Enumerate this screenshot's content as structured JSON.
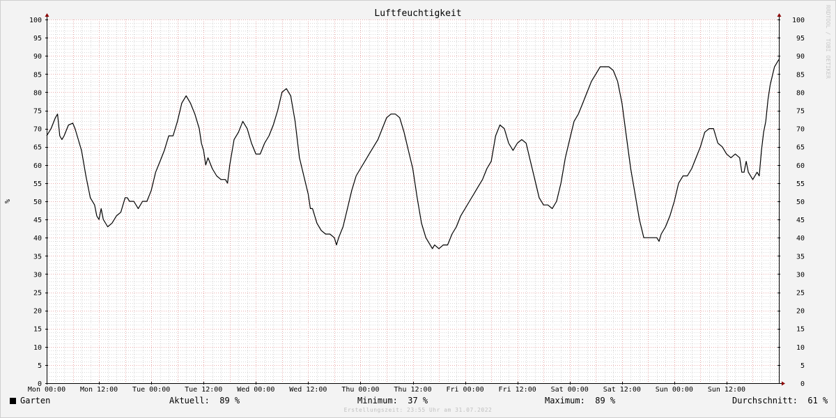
{
  "chart_data": {
    "type": "line",
    "title": "Luftfeuchtigkeit",
    "ylabel": "%",
    "ylim": [
      0,
      100
    ],
    "y_ticks": [
      0,
      5,
      10,
      15,
      20,
      25,
      30,
      35,
      40,
      45,
      50,
      55,
      60,
      65,
      70,
      75,
      80,
      85,
      90,
      95,
      100
    ],
    "xlim": [
      0,
      168
    ],
    "x_ticks": [
      {
        "x": 0,
        "label": "Mon 00:00"
      },
      {
        "x": 12,
        "label": "Mon 12:00"
      },
      {
        "x": 24,
        "label": "Tue 00:00"
      },
      {
        "x": 36,
        "label": "Tue 12:00"
      },
      {
        "x": 48,
        "label": "Wed 00:00"
      },
      {
        "x": 60,
        "label": "Wed 12:00"
      },
      {
        "x": 72,
        "label": "Thu 00:00"
      },
      {
        "x": 84,
        "label": "Thu 12:00"
      },
      {
        "x": 96,
        "label": "Fri 00:00"
      },
      {
        "x": 108,
        "label": "Fri 12:00"
      },
      {
        "x": 120,
        "label": "Sat 00:00"
      },
      {
        "x": 132,
        "label": "Sat 12:00"
      },
      {
        "x": 144,
        "label": "Sun 00:00"
      },
      {
        "x": 156,
        "label": "Sun 12:00"
      }
    ],
    "grid": true,
    "series": [
      {
        "name": "Garten",
        "color": "#000000",
        "points": [
          [
            0,
            68
          ],
          [
            1,
            70
          ],
          [
            2,
            73
          ],
          [
            2.5,
            74
          ],
          [
            3,
            68
          ],
          [
            3.5,
            67
          ],
          [
            4,
            68
          ],
          [
            5,
            71
          ],
          [
            6,
            71.5
          ],
          [
            6.5,
            70
          ],
          [
            7,
            68
          ],
          [
            8,
            64
          ],
          [
            9,
            57
          ],
          [
            10,
            51
          ],
          [
            11,
            49
          ],
          [
            11.5,
            46
          ],
          [
            12,
            45
          ],
          [
            12.5,
            48
          ],
          [
            13,
            45
          ],
          [
            14,
            43
          ],
          [
            15,
            44
          ],
          [
            16,
            46
          ],
          [
            17,
            47
          ],
          [
            18,
            51
          ],
          [
            18.5,
            51
          ],
          [
            19,
            50
          ],
          [
            20,
            50
          ],
          [
            21,
            48
          ],
          [
            22,
            50
          ],
          [
            23,
            50
          ],
          [
            24,
            53
          ],
          [
            25,
            58
          ],
          [
            26,
            61
          ],
          [
            27,
            64
          ],
          [
            28,
            68
          ],
          [
            29,
            68
          ],
          [
            30,
            72
          ],
          [
            31,
            77
          ],
          [
            32,
            79
          ],
          [
            33,
            77
          ],
          [
            34,
            74
          ],
          [
            35,
            70
          ],
          [
            35.5,
            66
          ],
          [
            36,
            64
          ],
          [
            36.5,
            60
          ],
          [
            37,
            62
          ],
          [
            38,
            59
          ],
          [
            39,
            57
          ],
          [
            40,
            56
          ],
          [
            41,
            56
          ],
          [
            41.5,
            55
          ],
          [
            42,
            60
          ],
          [
            43,
            67
          ],
          [
            44,
            69
          ],
          [
            45,
            72
          ],
          [
            46,
            70
          ],
          [
            47,
            66
          ],
          [
            48,
            63
          ],
          [
            49,
            63
          ],
          [
            50,
            66
          ],
          [
            51,
            68
          ],
          [
            52,
            71
          ],
          [
            53,
            75
          ],
          [
            54,
            80
          ],
          [
            55,
            81
          ],
          [
            56,
            79
          ],
          [
            57,
            72
          ],
          [
            58,
            62
          ],
          [
            59,
            57
          ],
          [
            60,
            52
          ],
          [
            60.5,
            48
          ],
          [
            61,
            48
          ],
          [
            62,
            44
          ],
          [
            63,
            42
          ],
          [
            64,
            41
          ],
          [
            65,
            41
          ],
          [
            66,
            40
          ],
          [
            66.5,
            38
          ],
          [
            67,
            40
          ],
          [
            68,
            43
          ],
          [
            69,
            48
          ],
          [
            70,
            53
          ],
          [
            71,
            57
          ],
          [
            72,
            59
          ],
          [
            73,
            61
          ],
          [
            74,
            63
          ],
          [
            75,
            65
          ],
          [
            76,
            67
          ],
          [
            77,
            70
          ],
          [
            78,
            73
          ],
          [
            79,
            74
          ],
          [
            80,
            74
          ],
          [
            81,
            73
          ],
          [
            82,
            69
          ],
          [
            83,
            64
          ],
          [
            84,
            59
          ],
          [
            85,
            51
          ],
          [
            86,
            44
          ],
          [
            87,
            40
          ],
          [
            88,
            38
          ],
          [
            88.5,
            37
          ],
          [
            89,
            38
          ],
          [
            90,
            37
          ],
          [
            91,
            38
          ],
          [
            92,
            38
          ],
          [
            93,
            41
          ],
          [
            94,
            43
          ],
          [
            95,
            46
          ],
          [
            96,
            48
          ],
          [
            97,
            50
          ],
          [
            98,
            52
          ],
          [
            99,
            54
          ],
          [
            100,
            56
          ],
          [
            101,
            59
          ],
          [
            102,
            61
          ],
          [
            103,
            68
          ],
          [
            104,
            71
          ],
          [
            105,
            70
          ],
          [
            106,
            66
          ],
          [
            107,
            64
          ],
          [
            108,
            66
          ],
          [
            109,
            67
          ],
          [
            110,
            66
          ],
          [
            111,
            61
          ],
          [
            112,
            56
          ],
          [
            113,
            51
          ],
          [
            114,
            49
          ],
          [
            115,
            49
          ],
          [
            116,
            48
          ],
          [
            117,
            50
          ],
          [
            118,
            55
          ],
          [
            119,
            62
          ],
          [
            120,
            67
          ],
          [
            121,
            72
          ],
          [
            122,
            74
          ],
          [
            123,
            77
          ],
          [
            124,
            80
          ],
          [
            125,
            83
          ],
          [
            126,
            85
          ],
          [
            127,
            87
          ],
          [
            128,
            87
          ],
          [
            129,
            87
          ],
          [
            130,
            86
          ],
          [
            131,
            83
          ],
          [
            132,
            77
          ],
          [
            133,
            68
          ],
          [
            134,
            59
          ],
          [
            135,
            52
          ],
          [
            136,
            45
          ],
          [
            137,
            40
          ],
          [
            138,
            40
          ],
          [
            139,
            40
          ],
          [
            140,
            40
          ],
          [
            140.5,
            39
          ],
          [
            141,
            41
          ],
          [
            142,
            43
          ],
          [
            143,
            46
          ],
          [
            144,
            50
          ],
          [
            145,
            55
          ],
          [
            146,
            57
          ],
          [
            147,
            57
          ],
          [
            148,
            59
          ],
          [
            149,
            62
          ],
          [
            150,
            65
          ],
          [
            151,
            69
          ],
          [
            152,
            70
          ],
          [
            153,
            70
          ],
          [
            154,
            66
          ],
          [
            155,
            65
          ],
          [
            156,
            63
          ],
          [
            157,
            62
          ],
          [
            158,
            63
          ],
          [
            159,
            62
          ],
          [
            159.5,
            58
          ],
          [
            160,
            58
          ],
          [
            160.5,
            61
          ],
          [
            161,
            58
          ],
          [
            162,
            56
          ],
          [
            162.5,
            57
          ],
          [
            163,
            58
          ],
          [
            163.5,
            57
          ],
          [
            164,
            64
          ],
          [
            164.5,
            69
          ],
          [
            165,
            72
          ],
          [
            165.5,
            78
          ],
          [
            166,
            82
          ],
          [
            167,
            87
          ],
          [
            168,
            89
          ]
        ]
      }
    ]
  },
  "legend": {
    "series_name": "Garten",
    "current_label": "Aktuell:",
    "current_value": "89 %",
    "min_label": "Minimum:",
    "min_value": "37 %",
    "max_label": "Maximum:",
    "max_value": "89 %",
    "avg_label": "Durchschnitt:",
    "avg_value": "61 %"
  },
  "footer": "Erstellungszeit: 23:55 Uhr am 31.07.2022",
  "watermark": "RRDTOOL / TOBI OETIKER"
}
